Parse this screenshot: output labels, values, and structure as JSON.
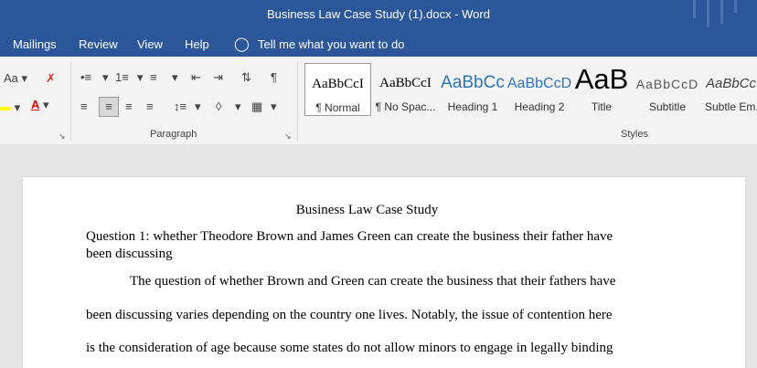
{
  "window": {
    "title": "Business Law Case Study (1).docx  -  Word"
  },
  "menu": {
    "items": [
      "Mailings",
      "Review",
      "View",
      "Help"
    ],
    "tell_me": "Tell me what you want to do"
  },
  "ribbon": {
    "font_group": {
      "change_case": "Aa"
    },
    "paragraph_group": {
      "label": "Paragraph"
    },
    "styles_group": {
      "label": "Styles",
      "styles": [
        {
          "sample": "AaBbCcI",
          "name": "¶ Normal"
        },
        {
          "sample": "AaBbCcI",
          "name": "¶ No Spac..."
        },
        {
          "sample": "AaBbCc",
          "name": "Heading 1"
        },
        {
          "sample": "AaBbCcD",
          "name": "Heading 2"
        },
        {
          "sample": "AaB",
          "name": "Title"
        },
        {
          "sample": "AaBbCcD",
          "name": "Subtitle"
        },
        {
          "sample": "AaBbCcI",
          "name": "Subtle Em..."
        }
      ]
    }
  },
  "document": {
    "title": "Business Law Case Study",
    "question_line1": "Question 1: whether Theodore Brown and James Green can create the business their father have",
    "question_line2": "been discussing",
    "body_line1": "The question of whether Brown and Green can create the business that their fathers have",
    "body_line2": "been discussing varies depending on the country one lives. Notably, the issue of contention here",
    "body_line3": "is the consideration of age because some states do not allow minors to engage in legally binding"
  },
  "colors": {
    "title_bar": "#2b579a",
    "ribbon": "#f3f3f3",
    "highlight": "#ffff00",
    "font_color": "#e00000"
  }
}
